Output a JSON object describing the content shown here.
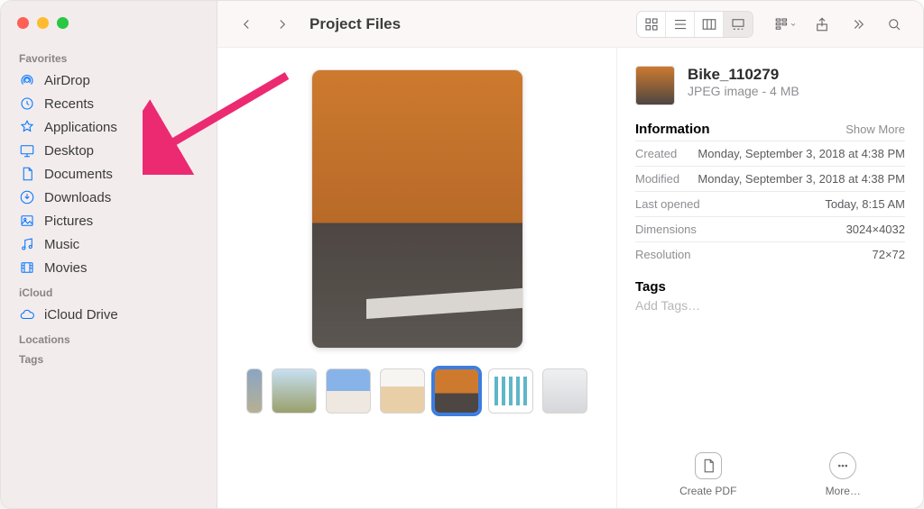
{
  "window_title": "Project Files",
  "sidebar": {
    "favorites_label": "Favorites",
    "icloud_label": "iCloud",
    "locations_label": "Locations",
    "tags_label": "Tags",
    "items": [
      {
        "label": "AirDrop",
        "icon": "airdrop-icon"
      },
      {
        "label": "Recents",
        "icon": "clock-icon"
      },
      {
        "label": "Applications",
        "icon": "apps-icon"
      },
      {
        "label": "Desktop",
        "icon": "desktop-icon"
      },
      {
        "label": "Documents",
        "icon": "document-icon"
      },
      {
        "label": "Downloads",
        "icon": "download-icon"
      },
      {
        "label": "Pictures",
        "icon": "pictures-icon"
      },
      {
        "label": "Music",
        "icon": "music-icon"
      },
      {
        "label": "Movies",
        "icon": "movies-icon"
      }
    ],
    "icloud_items": [
      {
        "label": "iCloud Drive",
        "icon": "icloud-icon"
      }
    ]
  },
  "file": {
    "name": "Bike_110279",
    "type_and_size": "JPEG image - 4 MB"
  },
  "info": {
    "header": "Information",
    "show_more": "Show More",
    "rows": [
      {
        "k": "Created",
        "v": "Monday, September 3, 2018 at 4:38 PM"
      },
      {
        "k": "Modified",
        "v": "Monday, September 3, 2018 at 4:38 PM"
      },
      {
        "k": "Last opened",
        "v": "Today, 8:15 AM"
      },
      {
        "k": "Dimensions",
        "v": "3024×4032"
      },
      {
        "k": "Resolution",
        "v": "72×72"
      }
    ]
  },
  "tags": {
    "header": "Tags",
    "hint": "Add Tags…"
  },
  "actions": {
    "create_pdf": "Create PDF",
    "more": "More…"
  }
}
